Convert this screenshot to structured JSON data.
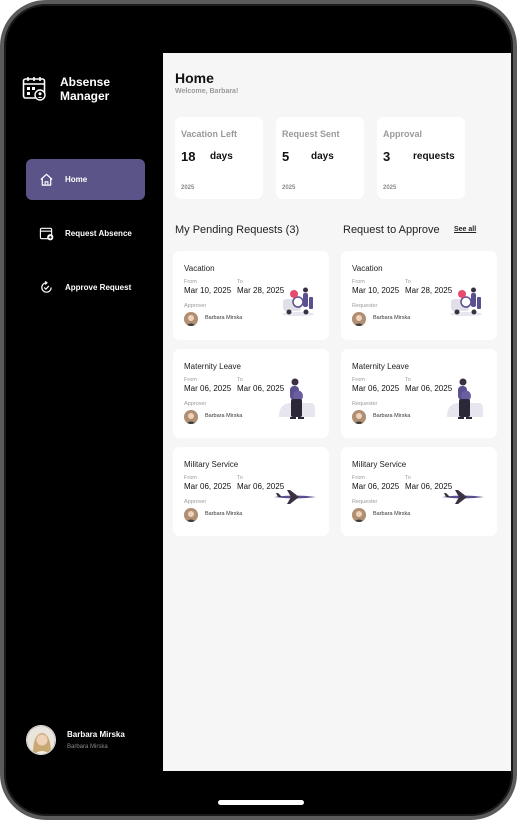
{
  "app": {
    "title": "Absense Manager",
    "title_line1": "Absense",
    "title_line2": "Manager"
  },
  "sidebar": {
    "items": [
      {
        "label": "Home",
        "icon": "home-icon",
        "active": true
      },
      {
        "label": "Request Absence",
        "icon": "calendar-add-icon",
        "active": false
      },
      {
        "label": "Approve Request",
        "icon": "approve-refresh-icon",
        "active": false
      }
    ],
    "profile": {
      "name": "Barbara Mirska",
      "subtitle": "Barbara Mirska"
    }
  },
  "header": {
    "title": "Home",
    "welcome": "Welcome, Barbara!"
  },
  "stats": [
    {
      "title": "Vacation Left",
      "value": "18",
      "unit": "days",
      "year": "2025"
    },
    {
      "title": "Request Sent",
      "value": "5",
      "unit": "days",
      "year": "2025"
    },
    {
      "title": "Approval",
      "value": "3",
      "unit": "requests",
      "year": "2025"
    }
  ],
  "pending": {
    "title": "My Pending Requests (3)",
    "person_label": "Approver",
    "from_label": "From",
    "to_label": "To",
    "items": [
      {
        "type": "Vacation",
        "from": "Mar 10, 2025",
        "to": "Mar 28, 2025",
        "person": "Barbara Mirska",
        "illustration": "vacation-illustration"
      },
      {
        "type": "Maternity Leave",
        "from": "Mar 06, 2025",
        "to": "Mar 06, 2025",
        "person": "Barbara Mirska",
        "illustration": "maternity-illustration"
      },
      {
        "type": "Military Service",
        "from": "Mar 06, 2025",
        "to": "Mar 06, 2025",
        "person": "Barbara Mirska",
        "illustration": "airplane-illustration"
      }
    ]
  },
  "to_approve": {
    "title": "Request to Approve",
    "see_all": "See all",
    "person_label": "Requester",
    "from_label": "From",
    "to_label": "To",
    "items": [
      {
        "type": "Vacation",
        "from": "Mar 10, 2025",
        "to": "Mar 28, 2025",
        "person": "Barbara Mirska",
        "illustration": "vacation-illustration"
      },
      {
        "type": "Maternity Leave",
        "from": "Mar 06, 2025",
        "to": "Mar 06, 2025",
        "person": "Barbara Mirska",
        "illustration": "maternity-illustration"
      },
      {
        "type": "Military Service",
        "from": "Mar 06, 2025",
        "to": "Mar 06, 2025",
        "person": "Barbara Mirska",
        "illustration": "airplane-illustration"
      }
    ]
  },
  "colors": {
    "accent": "#5b5488",
    "sidebar_bg": "#000000",
    "content_bg": "#f6f6f6",
    "card_bg": "#ffffff",
    "illustration_purple": "#5b4f8f"
  }
}
